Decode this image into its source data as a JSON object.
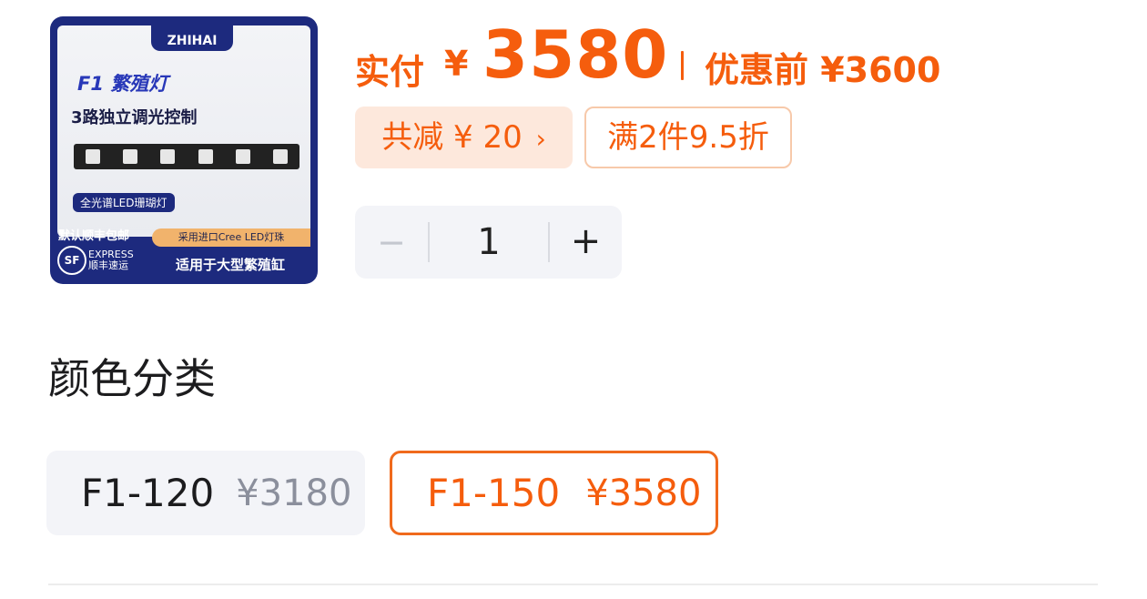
{
  "thumbnail": {
    "brand": "ZHIHAI",
    "product_name": "F1 繁殖灯",
    "subtitle": "3路独立调光控制",
    "chip": "全光谱LED珊瑚灯",
    "shipping": "默认顺丰包邮",
    "sf_logo": "SF",
    "sf_express": "EXPRESS",
    "sf_express_cn": "顺丰速运",
    "cree": "采用进口Cree  LED灯珠",
    "usage": "适用于大型繁殖缸"
  },
  "price": {
    "paid_label": "实付",
    "currency": "¥",
    "paid_value": "3580",
    "before_label": "优惠前 ¥3600"
  },
  "discount": {
    "total": "共减 ¥ 20",
    "chevron": "›",
    "promo": "满2件9.5折"
  },
  "stepper": {
    "minus": "−",
    "value": "1",
    "plus": "+"
  },
  "section": {
    "title": "颜色分类"
  },
  "options": [
    {
      "name": "F1-120",
      "price": "¥3180",
      "selected": false
    },
    {
      "name": "F1-150",
      "price": "¥3580",
      "selected": true
    }
  ],
  "colors": {
    "accent": "#f55d0d",
    "thumbnail_bg": "#1d2a7e"
  }
}
